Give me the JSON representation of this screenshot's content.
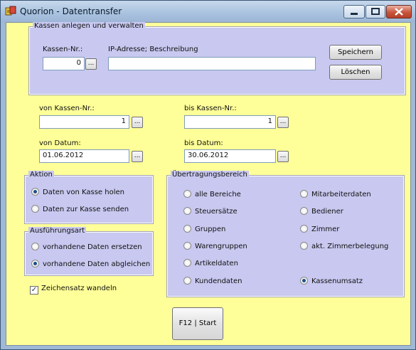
{
  "window": {
    "title": "Quorion - Datentransfer",
    "colors": {
      "client_bg": "#ffff99",
      "group_bg": "#c8c8f0",
      "title_bg": "#a9c2df"
    }
  },
  "kassen_group": {
    "label": "Kassen anlegen und verwalten",
    "kassen_nr_label": "Kassen-Nr.:",
    "kassen_nr_value": "0",
    "ip_label": "IP-Adresse; Beschreibung",
    "ip_value": "",
    "save_label": "Speichern",
    "delete_label": "Löschen"
  },
  "range": {
    "from_kasse_label": "von Kassen-Nr.:",
    "from_kasse_value": "1",
    "to_kasse_label": "bis Kassen-Nr.:",
    "to_kasse_value": "1",
    "from_date_label": "von Datum:",
    "from_date_value": "01.06.2012",
    "to_date_label": "bis Datum:",
    "to_date_value": "30.06.2012",
    "ellipsis": "..."
  },
  "aktion": {
    "label": "Aktion",
    "options": [
      "Daten von Kasse holen",
      "Daten zur Kasse senden"
    ],
    "selected": 0
  },
  "ausfuehrung": {
    "label": "Ausführungsart",
    "options": [
      "vorhandene Daten ersetzen",
      "vorhandene Daten abgleichen"
    ],
    "selected": 1
  },
  "zeichensatz": {
    "label": "Zeichensatz wandeln",
    "checked": true,
    "check_glyph": "✓"
  },
  "bereich": {
    "label": "Übertragungsbereich",
    "left": [
      "alle Bereiche",
      "Steuersätze",
      "Gruppen",
      "Warengruppen",
      "Artikeldaten",
      "Kundendaten"
    ],
    "right": [
      "Mitarbeiterdaten",
      "Bediener",
      "Zimmer",
      "akt. Zimmerbelegung",
      "Kassenumsatz"
    ],
    "selected": "Kassenumsatz"
  },
  "start_button": {
    "label": "F12 | Start"
  }
}
